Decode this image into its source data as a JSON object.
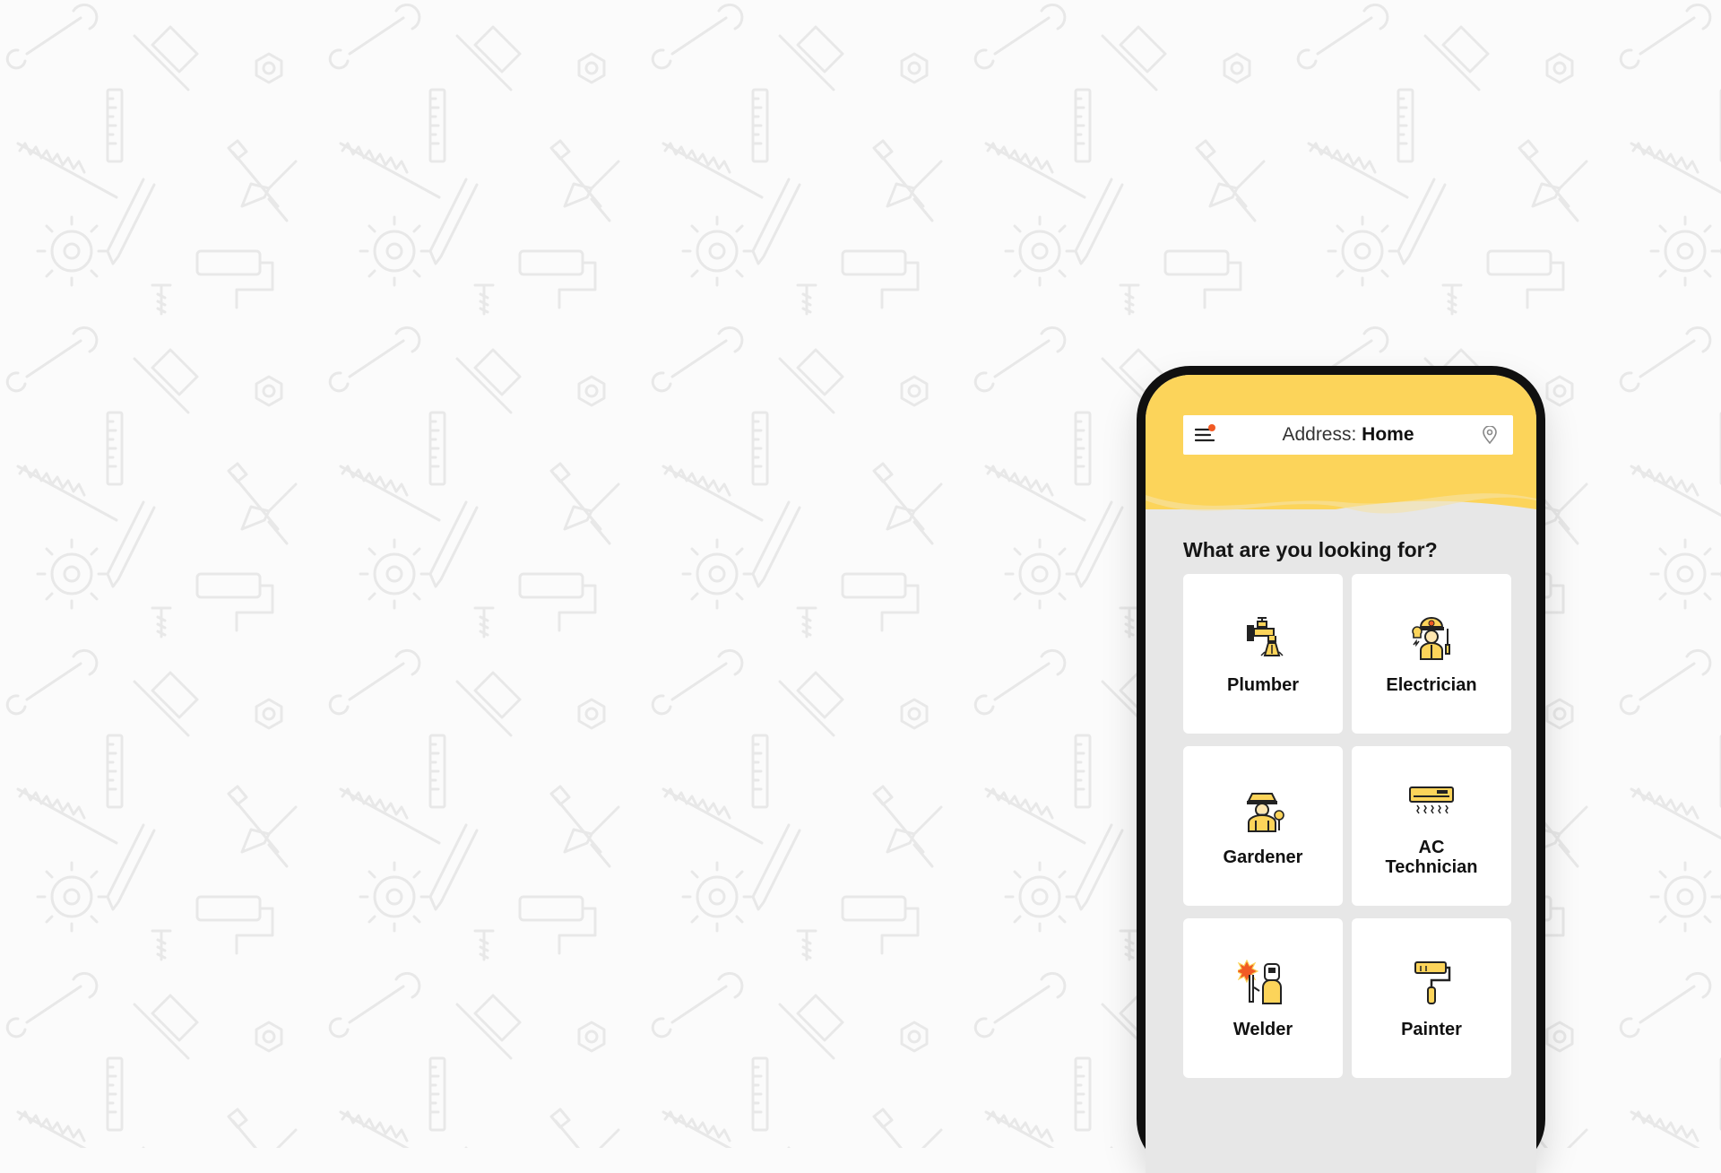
{
  "header": {
    "menu_icon": "menu-icon",
    "notification_dot_color": "#f15a24",
    "address_label": "Address:",
    "address_value": "Home",
    "location_icon": "location-pin-icon",
    "accent_color": "#fcd45a"
  },
  "main": {
    "title": "What are you looking for?",
    "categories": [
      {
        "label": "Plumber",
        "icon": "faucet-icon"
      },
      {
        "label": "Electrician",
        "icon": "electrician-icon"
      },
      {
        "label": "Gardener",
        "icon": "gardener-icon"
      },
      {
        "label": "AC Technician",
        "icon": "air-conditioner-icon"
      },
      {
        "label": "Welder",
        "icon": "welder-icon"
      },
      {
        "label": "Painter",
        "icon": "paint-roller-icon"
      }
    ]
  }
}
